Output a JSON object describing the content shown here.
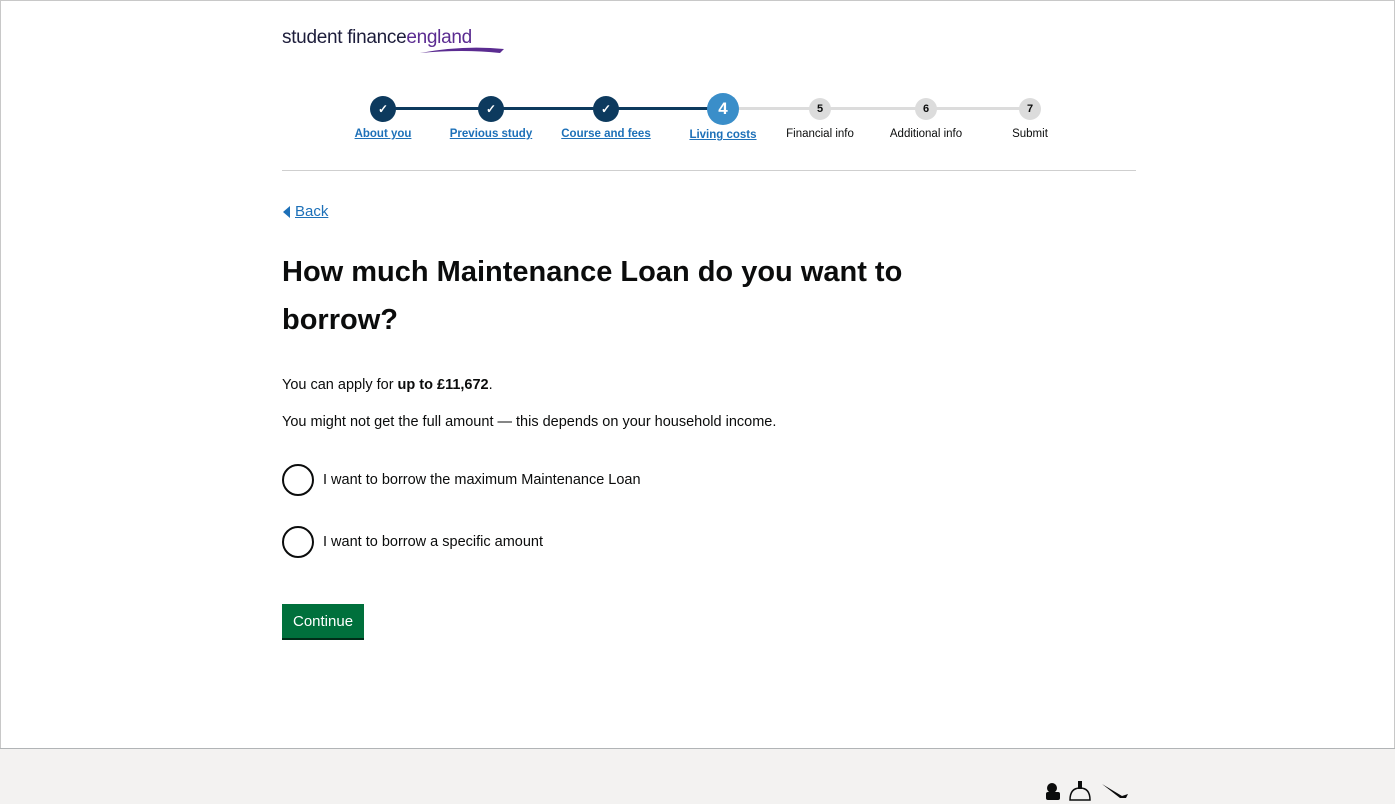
{
  "brand": {
    "part1": "student finance",
    "part2": "england"
  },
  "progress": {
    "steps": [
      {
        "number": "✓",
        "label": "About you",
        "state": "done"
      },
      {
        "number": "✓",
        "label": "Previous study",
        "state": "done"
      },
      {
        "number": "✓",
        "label": "Course and fees",
        "state": "done"
      },
      {
        "number": "4",
        "label": "Living costs",
        "state": "current"
      },
      {
        "number": "5",
        "label": "Financial info",
        "state": "todo"
      },
      {
        "number": "6",
        "label": "Additional info",
        "state": "todo"
      },
      {
        "number": "7",
        "label": "Submit",
        "state": "todo"
      }
    ]
  },
  "back_label": "Back",
  "heading": "How much Maintenance Loan do you want to borrow?",
  "intro": {
    "prefix": "You can apply for ",
    "amount": "up to £11,672",
    "suffix": "."
  },
  "note": "You might not get the full amount — this depends on your household income.",
  "options": [
    {
      "label": "I want to borrow the maximum Maintenance Loan"
    },
    {
      "label": "I want to borrow a specific amount"
    }
  ],
  "continue_label": "Continue",
  "colors": {
    "accent": "#1d70b8",
    "done": "#0d3a5e",
    "current": "#3a8ec9",
    "button": "#00703c"
  }
}
